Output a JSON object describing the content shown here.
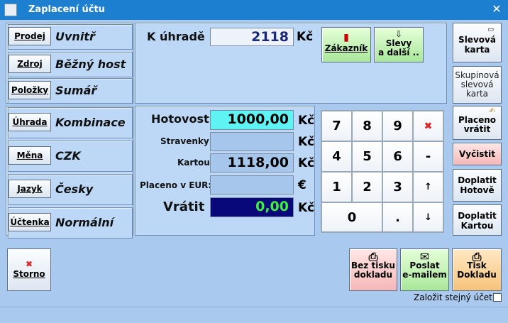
{
  "window": {
    "title": "Zaplacení účtu",
    "close": "✕"
  },
  "left": {
    "rows": [
      {
        "button": "Prodej",
        "value": "Uvnitř"
      },
      {
        "button": "Zdroj",
        "value": "Běžný host"
      },
      {
        "button": "Položky",
        "value": "Sumář"
      },
      {
        "button": "Úhrada",
        "value": "Kombinace"
      },
      {
        "button": "Měna",
        "value": "CZK"
      },
      {
        "button": "Jazyk",
        "value": "Česky"
      },
      {
        "button": "Účtenka",
        "value": "Normální"
      }
    ]
  },
  "payment": {
    "to_pay_label": "K úhradě",
    "to_pay_value": "2118",
    "currency": "Kč",
    "cash_label": "Hotovost",
    "cash_value": "1000,00",
    "meal_label": "Stravenky",
    "meal_value": "",
    "card_label": "Kartou",
    "card_value": "1118,00",
    "eur_label": "Placeno v EUR:",
    "eur_value": "",
    "eur_symbol": "€",
    "return_label": "Vrátit",
    "return_value": "0,00"
  },
  "actions": {
    "customer": "Zákazník",
    "discounts_line1": "Slevy",
    "discounts_line2": "a další ..",
    "discount_card_line1": "Slevová",
    "discount_card_line2": "karta",
    "group_card_line1": "Skupinová",
    "group_card_line2": "slevová",
    "group_card_line3": "karta",
    "paid_back_line1": "Placeno",
    "paid_back_line2": "vrátit",
    "clear": "Vyčistit",
    "pay_cash_line1": "Doplatit",
    "pay_cash_line2": "Hotově",
    "pay_card_line1": "Doplatit",
    "pay_card_line2": "Kartou"
  },
  "keypad": {
    "keys": [
      "7",
      "8",
      "9",
      "4",
      "5",
      "6",
      "1",
      "2",
      "3",
      "0",
      "."
    ],
    "minus": "-",
    "up": "↑",
    "down": "↓",
    "delete_icon": "x-icon"
  },
  "bottom": {
    "storno": "Storno",
    "no_print_line1": "Bez tisku",
    "no_print_line2": "dokladu",
    "email_line1": "Poslat",
    "email_line2": "e-mailem",
    "print_line1": "Tisk",
    "print_line2": "Dokladu",
    "same_account": "Založit stejný účet"
  }
}
